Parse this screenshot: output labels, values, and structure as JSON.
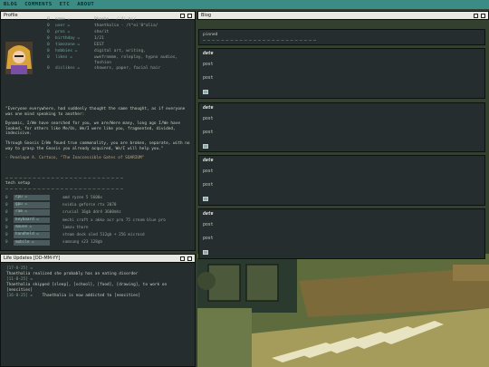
{
  "nav": {
    "items": [
      "BLOG",
      "COMMENTS",
      "ETC",
      "ABOUT"
    ]
  },
  "profile": {
    "title": "Profile",
    "fields": [
      {
        "n": "0",
        "key": "name =",
        "value": "Phoebe - /'fi:bi/"
      },
      {
        "n": "0",
        "key": "user =",
        "value": "thaethalia - /t^ei'0^alia/"
      },
      {
        "n": "0",
        "key": "pros =",
        "value": "she/it"
      },
      {
        "n": "0",
        "key": "birthday =",
        "value": "1/21"
      },
      {
        "n": "0",
        "key": "timezone =",
        "value": "EEST"
      },
      {
        "n": "0",
        "key": "hobbies =",
        "value": "digital art, writing,"
      },
      {
        "n": "0",
        "key": "likes =",
        "value": "wwefromme, roleplay, hypno audios, fashion"
      },
      {
        "n": "0",
        "key": "dislikes =",
        "value": "showers, paper, facial hair"
      }
    ],
    "quote": [
      "\"Everyone everywhere, had suddenly thought the same thought, as if everyone was one mind speaking to another:",
      "Dynamic, I/We have searched for you, we are/Were many, long ago I/We have looked, for others like Me/Us, We/I were like you, fragmented, divided, indecisive.",
      "Through Gnosis I/We found true commonality, you are broken, separate, with no way to grasp the Gnosis you already acquired, We/I will help you.\""
    ],
    "attribution": "- Penelope A. Cortoco, \"The Inaccessible Gates of SOARIUM\"",
    "tech_title": "tech setup",
    "tech": [
      {
        "n": "0",
        "key": "cpu =",
        "value": "amd ryzen 5 5600x"
      },
      {
        "n": "0",
        "key": "gpu =",
        "value": "nvidia geforce rtx 3070"
      },
      {
        "n": "0",
        "key": "ram =",
        "value": "crucial 16gb ddr4 3600mhz"
      },
      {
        "n": "0",
        "key": "keyboard =",
        "value": "mechi craft x akko acr pro 75 cream blue pro"
      },
      {
        "n": "0",
        "key": "mouse =",
        "value": "lamzu thorn"
      },
      {
        "n": "0",
        "key": "handheld =",
        "value": "steam deck oled 512gb + 256 microsd"
      },
      {
        "n": "0",
        "key": "mobile =",
        "value": "samsung s23 128gb"
      }
    ]
  },
  "life": {
    "title": "Life Updates [DD-MM-YY]",
    "entries": [
      {
        "date": "[17-8-25] =",
        "text": ""
      },
      {
        "date": "",
        "text": "Thaethalia realized she probably has an eating disorder"
      },
      {
        "date": "[11-8-25] =",
        "text": ""
      },
      {
        "date": "",
        "text": "Thaethalia skipped [sleep], [school], [food], [drawing], to work on [neocities]"
      },
      {
        "date": "[16-8-25] =",
        "text": "Thaethalia is now addicted to [neocities]"
      }
    ]
  },
  "blog": {
    "title": "Blog",
    "pinned": "pinned",
    "posts": [
      {
        "date": "date",
        "lines": [
          "post",
          "post"
        ]
      },
      {
        "date": "date",
        "lines": [
          "post",
          "post"
        ]
      },
      {
        "date": "date",
        "lines": [
          "post",
          "post"
        ]
      },
      {
        "date": "date",
        "lines": [
          "post",
          "post"
        ]
      }
    ]
  }
}
